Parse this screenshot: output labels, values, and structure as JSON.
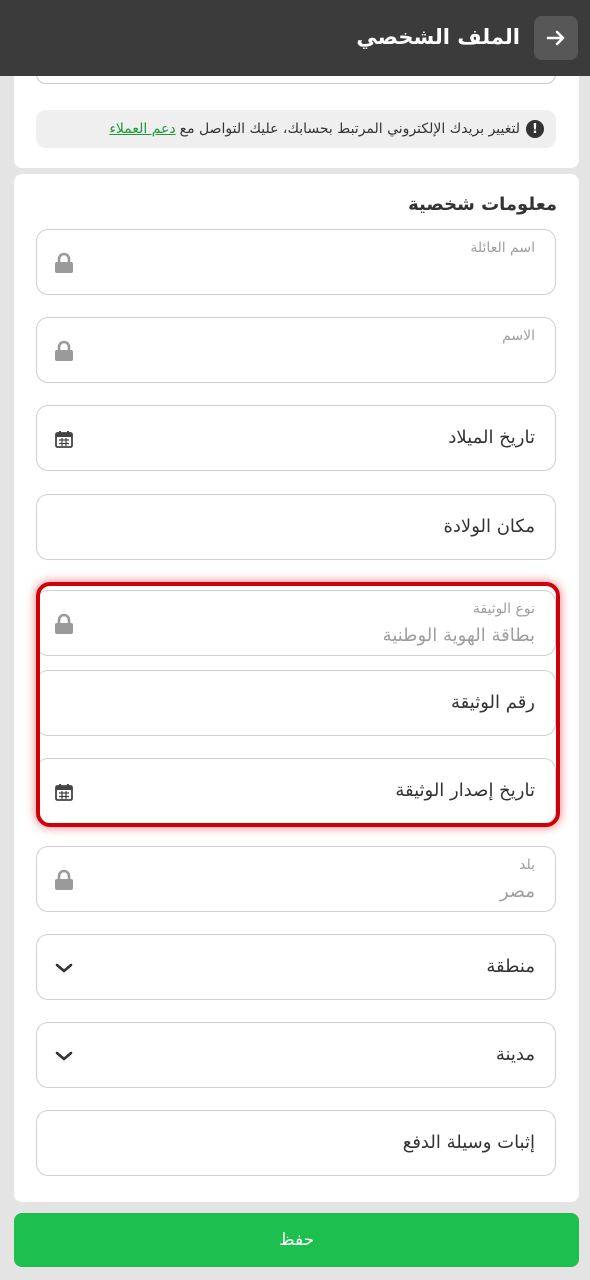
{
  "header": {
    "title": "الملف الشخصي"
  },
  "notice": {
    "text": "لتغيير بريدك الإلكتروني المرتبط بحسابك، عليك التواصل مع",
    "link": "دعم العملاء",
    "icon": "exclamation-icon"
  },
  "section": {
    "title": "معلومات شخصية"
  },
  "fields": {
    "last_name": {
      "label": "اسم العائلة",
      "value": "",
      "locked": true
    },
    "first_name": {
      "label": "الاسم",
      "value": "",
      "locked": true
    },
    "birth_date": {
      "label": "تاريخ الميلاد",
      "icon": "calendar-icon"
    },
    "birth_place": {
      "label": "مكان الولادة"
    },
    "doc_type": {
      "label": "نوع الوثيقة",
      "value": "بطاقة الهوية الوطنية",
      "locked": true
    },
    "doc_number": {
      "label": "رقم الوثيقة"
    },
    "doc_issue_date": {
      "label": "تاريخ إصدار الوثيقة",
      "icon": "calendar-icon"
    },
    "country": {
      "label": "بلد",
      "value": "مصر",
      "locked": true
    },
    "region": {
      "label": "منطقة",
      "icon": "chevron-down-icon"
    },
    "city": {
      "label": "مدينة",
      "icon": "chevron-down-icon"
    },
    "payment_proof": {
      "label": "إثبات وسيلة الدفع"
    }
  },
  "actions": {
    "save_label": "حفظ"
  },
  "colors": {
    "header_bg": "#3b3b3b",
    "save_green": "#1dbf4f",
    "link_green": "#1a9a3a",
    "highlight_red": "#d0000a"
  }
}
